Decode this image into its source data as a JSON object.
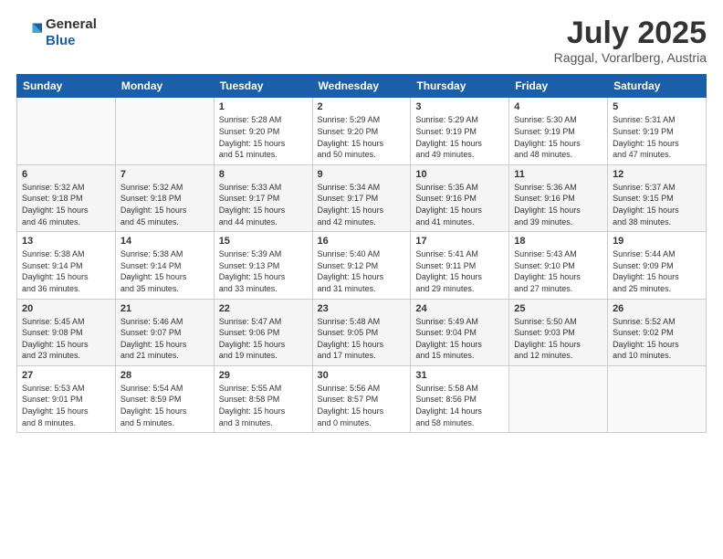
{
  "header": {
    "logo_line1": "General",
    "logo_line2": "Blue",
    "month": "July 2025",
    "location": "Raggal, Vorarlberg, Austria"
  },
  "weekdays": [
    "Sunday",
    "Monday",
    "Tuesday",
    "Wednesday",
    "Thursday",
    "Friday",
    "Saturday"
  ],
  "weeks": [
    [
      {
        "day": "",
        "info": ""
      },
      {
        "day": "",
        "info": ""
      },
      {
        "day": "1",
        "info": "Sunrise: 5:28 AM\nSunset: 9:20 PM\nDaylight: 15 hours\nand 51 minutes."
      },
      {
        "day": "2",
        "info": "Sunrise: 5:29 AM\nSunset: 9:20 PM\nDaylight: 15 hours\nand 50 minutes."
      },
      {
        "day": "3",
        "info": "Sunrise: 5:29 AM\nSunset: 9:19 PM\nDaylight: 15 hours\nand 49 minutes."
      },
      {
        "day": "4",
        "info": "Sunrise: 5:30 AM\nSunset: 9:19 PM\nDaylight: 15 hours\nand 48 minutes."
      },
      {
        "day": "5",
        "info": "Sunrise: 5:31 AM\nSunset: 9:19 PM\nDaylight: 15 hours\nand 47 minutes."
      }
    ],
    [
      {
        "day": "6",
        "info": "Sunrise: 5:32 AM\nSunset: 9:18 PM\nDaylight: 15 hours\nand 46 minutes."
      },
      {
        "day": "7",
        "info": "Sunrise: 5:32 AM\nSunset: 9:18 PM\nDaylight: 15 hours\nand 45 minutes."
      },
      {
        "day": "8",
        "info": "Sunrise: 5:33 AM\nSunset: 9:17 PM\nDaylight: 15 hours\nand 44 minutes."
      },
      {
        "day": "9",
        "info": "Sunrise: 5:34 AM\nSunset: 9:17 PM\nDaylight: 15 hours\nand 42 minutes."
      },
      {
        "day": "10",
        "info": "Sunrise: 5:35 AM\nSunset: 9:16 PM\nDaylight: 15 hours\nand 41 minutes."
      },
      {
        "day": "11",
        "info": "Sunrise: 5:36 AM\nSunset: 9:16 PM\nDaylight: 15 hours\nand 39 minutes."
      },
      {
        "day": "12",
        "info": "Sunrise: 5:37 AM\nSunset: 9:15 PM\nDaylight: 15 hours\nand 38 minutes."
      }
    ],
    [
      {
        "day": "13",
        "info": "Sunrise: 5:38 AM\nSunset: 9:14 PM\nDaylight: 15 hours\nand 36 minutes."
      },
      {
        "day": "14",
        "info": "Sunrise: 5:38 AM\nSunset: 9:14 PM\nDaylight: 15 hours\nand 35 minutes."
      },
      {
        "day": "15",
        "info": "Sunrise: 5:39 AM\nSunset: 9:13 PM\nDaylight: 15 hours\nand 33 minutes."
      },
      {
        "day": "16",
        "info": "Sunrise: 5:40 AM\nSunset: 9:12 PM\nDaylight: 15 hours\nand 31 minutes."
      },
      {
        "day": "17",
        "info": "Sunrise: 5:41 AM\nSunset: 9:11 PM\nDaylight: 15 hours\nand 29 minutes."
      },
      {
        "day": "18",
        "info": "Sunrise: 5:43 AM\nSunset: 9:10 PM\nDaylight: 15 hours\nand 27 minutes."
      },
      {
        "day": "19",
        "info": "Sunrise: 5:44 AM\nSunset: 9:09 PM\nDaylight: 15 hours\nand 25 minutes."
      }
    ],
    [
      {
        "day": "20",
        "info": "Sunrise: 5:45 AM\nSunset: 9:08 PM\nDaylight: 15 hours\nand 23 minutes."
      },
      {
        "day": "21",
        "info": "Sunrise: 5:46 AM\nSunset: 9:07 PM\nDaylight: 15 hours\nand 21 minutes."
      },
      {
        "day": "22",
        "info": "Sunrise: 5:47 AM\nSunset: 9:06 PM\nDaylight: 15 hours\nand 19 minutes."
      },
      {
        "day": "23",
        "info": "Sunrise: 5:48 AM\nSunset: 9:05 PM\nDaylight: 15 hours\nand 17 minutes."
      },
      {
        "day": "24",
        "info": "Sunrise: 5:49 AM\nSunset: 9:04 PM\nDaylight: 15 hours\nand 15 minutes."
      },
      {
        "day": "25",
        "info": "Sunrise: 5:50 AM\nSunset: 9:03 PM\nDaylight: 15 hours\nand 12 minutes."
      },
      {
        "day": "26",
        "info": "Sunrise: 5:52 AM\nSunset: 9:02 PM\nDaylight: 15 hours\nand 10 minutes."
      }
    ],
    [
      {
        "day": "27",
        "info": "Sunrise: 5:53 AM\nSunset: 9:01 PM\nDaylight: 15 hours\nand 8 minutes."
      },
      {
        "day": "28",
        "info": "Sunrise: 5:54 AM\nSunset: 8:59 PM\nDaylight: 15 hours\nand 5 minutes."
      },
      {
        "day": "29",
        "info": "Sunrise: 5:55 AM\nSunset: 8:58 PM\nDaylight: 15 hours\nand 3 minutes."
      },
      {
        "day": "30",
        "info": "Sunrise: 5:56 AM\nSunset: 8:57 PM\nDaylight: 15 hours\nand 0 minutes."
      },
      {
        "day": "31",
        "info": "Sunrise: 5:58 AM\nSunset: 8:56 PM\nDaylight: 14 hours\nand 58 minutes."
      },
      {
        "day": "",
        "info": ""
      },
      {
        "day": "",
        "info": ""
      }
    ]
  ]
}
